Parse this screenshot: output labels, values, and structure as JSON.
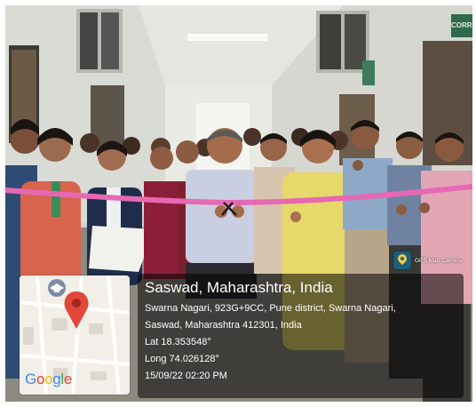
{
  "scene": {
    "description_hidden": true
  },
  "signage": {
    "corridor_sign": "CORRIDOR"
  },
  "gps_camera": {
    "badge_label": "GPS Map Camera",
    "place": "Saswad, Maharashtra, India",
    "address_line1": "Swarna Nagari, 923G+9CC, Pune district, Swarna Nagari,",
    "address_line2": "Saswad, Maharashtra 412301, India",
    "latitude": "Lat 18.353548°",
    "longitude": "Long 74.026128°",
    "datetime": "15/09/22 02:20 PM"
  },
  "map": {
    "logo_letters": [
      "G",
      "o",
      "o",
      "g",
      "l",
      "e"
    ],
    "pin_color": "#e2473a",
    "school_icon": "graduation-cap-icon"
  },
  "colors": {
    "ribbon": "#e768b3",
    "overlay": "#000000",
    "sign_green": "#2f6a4e"
  }
}
